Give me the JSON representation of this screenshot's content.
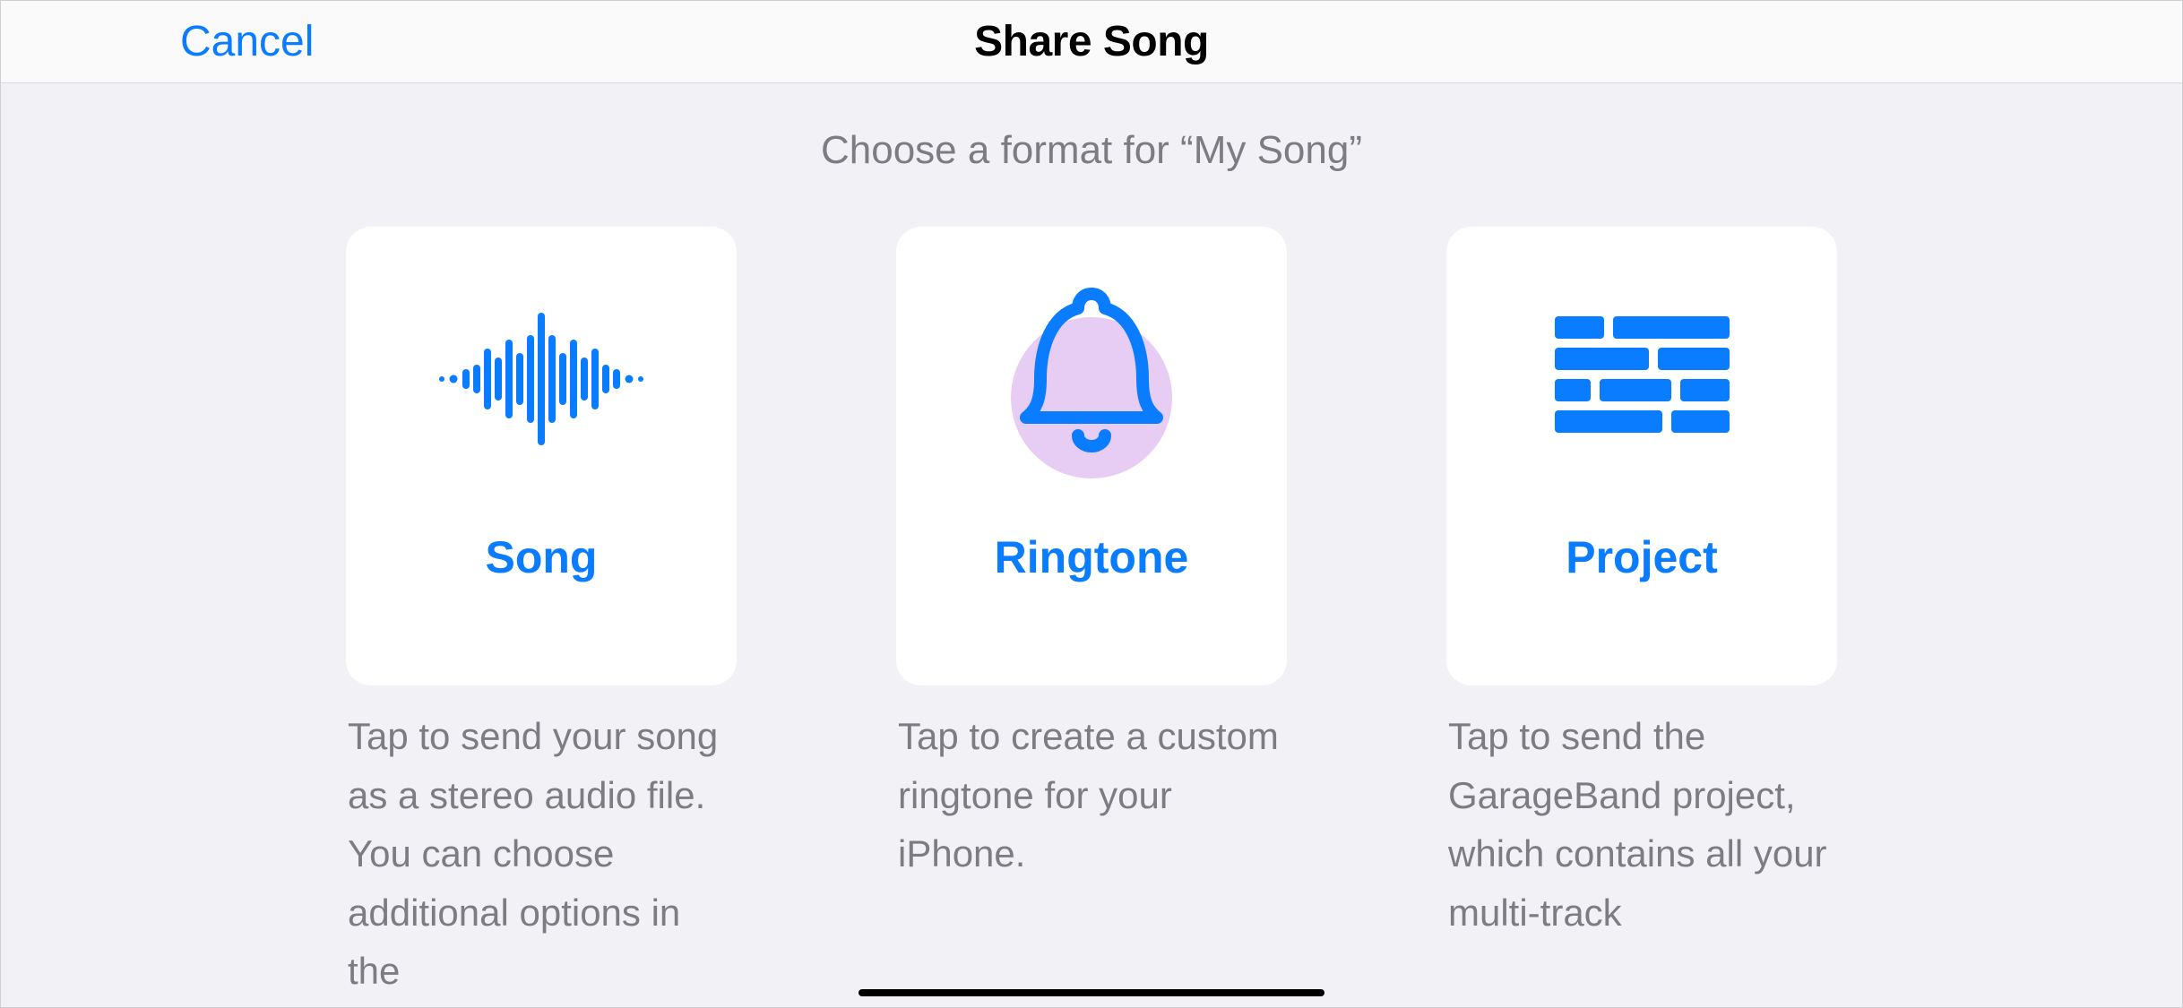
{
  "nav": {
    "cancel": "Cancel",
    "title": "Share Song"
  },
  "subtitle": "Choose a format for “My Song”",
  "options": {
    "song": {
      "title": "Song",
      "icon": "waveform-icon",
      "description": "Tap to send your song as a stereo audio file. You can choose additional options in the"
    },
    "ringtone": {
      "title": "Ringtone",
      "icon": "bell-icon",
      "description": "Tap to create a custom ringtone for your iPhone."
    },
    "project": {
      "title": "Project",
      "icon": "tracks-icon",
      "description": "Tap to send the GarageBand project, which contains all your multi-track"
    }
  },
  "colors": {
    "accent": "#0a7cff",
    "secondary_text": "#7c7c82",
    "card_bg": "#ffffff",
    "page_bg": "#f2f2f6",
    "circle_bg": "#e7cdf3"
  }
}
